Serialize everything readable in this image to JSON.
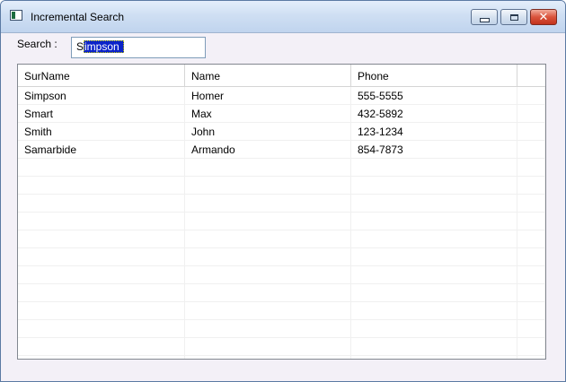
{
  "window": {
    "title": "Incremental Search",
    "icon": "app-window-icon",
    "controls": {
      "minimize": "minimize-icon",
      "maximize": "maximize-icon",
      "close": "close-icon"
    }
  },
  "search": {
    "label": "Search :",
    "value": "Simpson",
    "typed": "S",
    "autocompleted": "impson"
  },
  "table": {
    "columns": [
      "SurName",
      "Name",
      "Phone"
    ],
    "rows": [
      [
        "Simpson",
        "Homer",
        "555-5555"
      ],
      [
        "Smart",
        "Max",
        "432-5892"
      ],
      [
        "Smith",
        "John",
        "123-1234"
      ],
      [
        "Samarbide",
        "Armando",
        "854-7873"
      ]
    ]
  },
  "colors": {
    "selection": "#0b23c9",
    "close_button": "#d9533c",
    "titlebar": "#cfdff3"
  }
}
